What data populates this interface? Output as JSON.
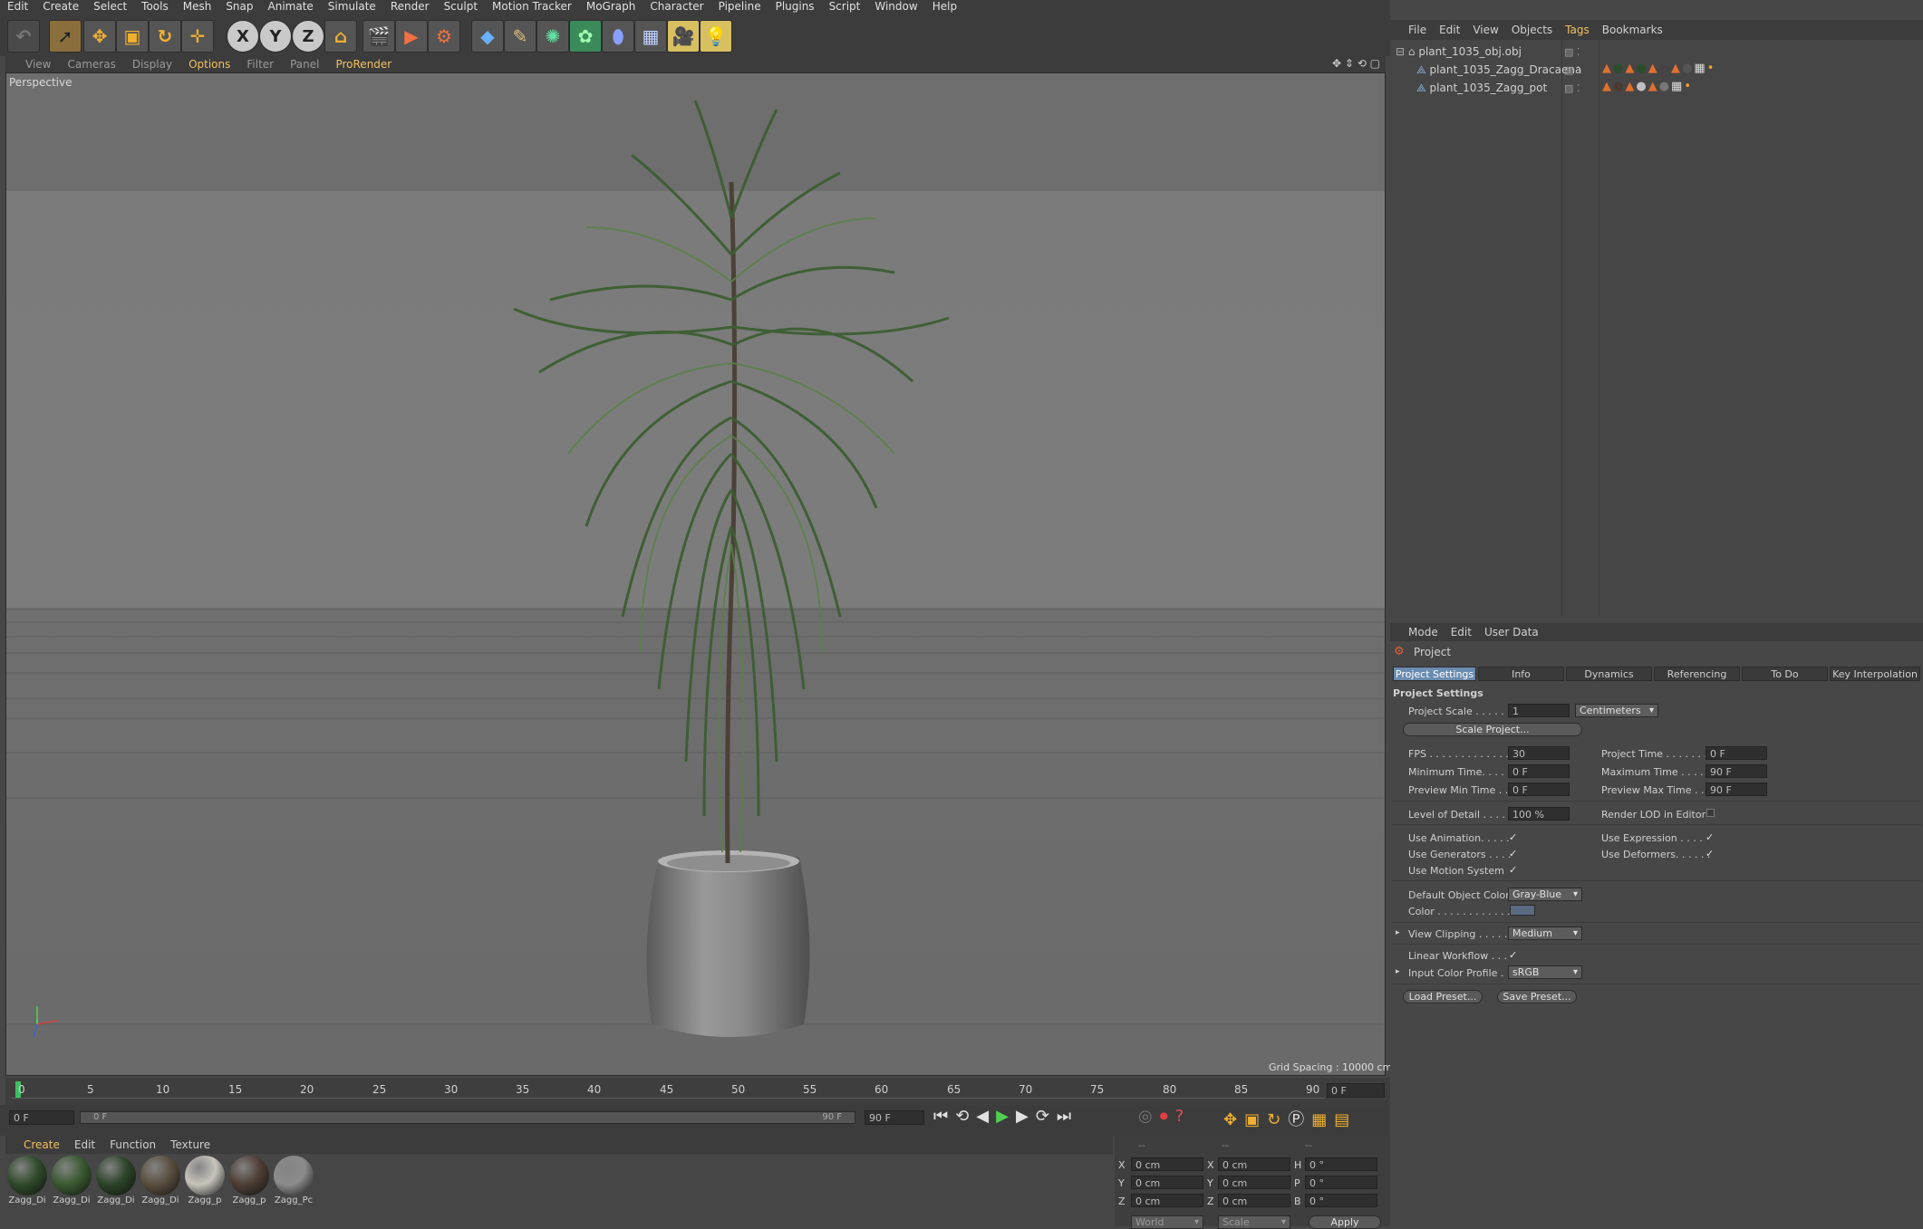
{
  "menubar": [
    "Edit",
    "Create",
    "Select",
    "Tools",
    "Mesh",
    "Snap",
    "Animate",
    "Simulate",
    "Render",
    "Sculpt",
    "Motion Tracker",
    "MoGraph",
    "Character",
    "Pipeline",
    "Plugins",
    "Script",
    "Window",
    "Help"
  ],
  "toolbar": {
    "axes": [
      "X",
      "Y",
      "Z"
    ]
  },
  "viewport": {
    "menu": [
      "View",
      "Cameras",
      "Display",
      "Options",
      "Filter",
      "Panel",
      "ProRender"
    ],
    "label": "Perspective",
    "grid_spacing": "Grid Spacing : 10000 cm"
  },
  "timeline": {
    "ticks": [
      "0",
      "5",
      "10",
      "15",
      "20",
      "25",
      "30",
      "35",
      "40",
      "45",
      "50",
      "55",
      "60",
      "65",
      "70",
      "75",
      "80",
      "85",
      "90"
    ],
    "current_frame": "0 F",
    "start_field": "0 F",
    "range_start": "0 F",
    "range_end": "90 F",
    "end_field": "90 F"
  },
  "materials": {
    "menu": [
      "Create",
      "Edit",
      "Function",
      "Texture"
    ],
    "items": [
      "Zagg_Di",
      "Zagg_Di",
      "Zagg_Di",
      "Zagg_Di",
      "Zagg_p",
      "Zagg_p",
      "Zagg_Pc"
    ],
    "colors": [
      "#2f4a2a",
      "#3a5a30",
      "#2c4428",
      "#5a4e3e",
      "#c8c4bc",
      "#4e3e34",
      "#8c8c8c"
    ]
  },
  "coordinates": {
    "header": [
      "--",
      "--",
      "--"
    ],
    "rows": [
      {
        "a": "X",
        "av": "0 cm",
        "b": "X",
        "bv": "0 cm",
        "c": "H",
        "cv": "0 °"
      },
      {
        "a": "Y",
        "av": "0 cm",
        "b": "Y",
        "bv": "0 cm",
        "c": "P",
        "cv": "0 °"
      },
      {
        "a": "Z",
        "av": "0 cm",
        "b": "Z",
        "bv": "0 cm",
        "c": "B",
        "cv": "0 °"
      }
    ],
    "world": "World",
    "scale": "Scale",
    "apply": "Apply"
  },
  "object_manager": {
    "menu": [
      "File",
      "Edit",
      "View",
      "Objects",
      "Tags",
      "Bookmarks"
    ],
    "objects": [
      "plant_1035_obj.obj",
      "plant_1035_Zagg_Dracaena",
      "plant_1035_Zagg_pot"
    ]
  },
  "attributes": {
    "menu": [
      "Mode",
      "Edit",
      "User Data"
    ],
    "title": "Project",
    "tabs": [
      "Project Settings",
      "Info",
      "Dynamics",
      "Referencing",
      "To Do",
      "Key Interpolation"
    ],
    "section": "Project Settings",
    "project_scale_label": "Project Scale . . . . . .",
    "project_scale_value": "1",
    "project_scale_unit": "Centimeters",
    "scale_project_btn": "Scale Project...",
    "fps_label": "FPS . . . . . . . . . . . . . .",
    "fps_value": "30",
    "project_time_label": "Project Time . . . . . . .",
    "project_time_value": "0 F",
    "min_time_label": "Minimum Time. . . . .",
    "min_time_value": "0 F",
    "max_time_label": "Maximum Time . . . . .",
    "max_time_value": "90 F",
    "prev_min_label": "Preview Min Time . .",
    "prev_min_value": "0 F",
    "prev_max_label": "Preview Max Time . . .",
    "prev_max_value": "90 F",
    "lod_label": "Level of Detail . . . . .",
    "lod_value": "100 %",
    "render_lod_label": "Render LOD in Editor",
    "use_animation": "Use Animation. . . . .",
    "use_expression": "Use Expression . . . .",
    "use_generators": "Use Generators . . . .",
    "use_deformers": "Use Deformers. . . . . .",
    "use_motion": "Use Motion System",
    "default_color_label": "Default Object Color",
    "default_color_value": "Gray-Blue",
    "color_label": "Color . . . . . . . . . . . .",
    "color_swatch": "#5a6a80",
    "view_clipping_label": "View Clipping . . . . .",
    "view_clipping_value": "Medium",
    "linear_workflow": "Linear Workflow . . .",
    "input_color_label": "Input Color Profile . .",
    "input_color_value": "sRGB",
    "load_preset": "Load Preset...",
    "save_preset": "Save Preset..."
  }
}
